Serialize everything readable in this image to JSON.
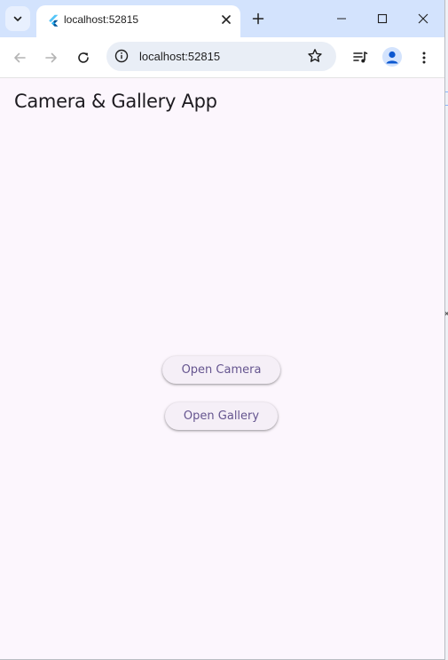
{
  "browser": {
    "tab": {
      "title": "localhost:52815"
    },
    "omnibox": {
      "url": "localhost:52815"
    },
    "colors": {
      "tabbar": "#d3e3fd",
      "omnibox": "#e9eef6",
      "page_background": "#fcf6fd"
    }
  },
  "app": {
    "title": "Camera & Gallery App",
    "buttons": {
      "open_camera": "Open Camera",
      "open_gallery": "Open Gallery"
    },
    "colors": {
      "button_text": "#65558f",
      "button_background": "#f5eff7",
      "title_text": "#1d1b20"
    }
  }
}
